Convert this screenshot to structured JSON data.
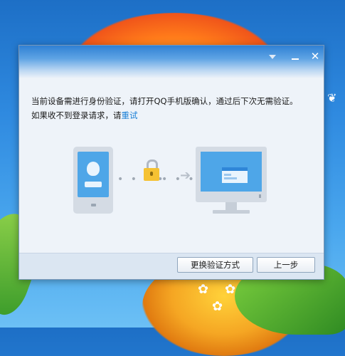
{
  "dialog": {
    "window_controls": {
      "dropdown_icon": "triangle-down-icon",
      "minimize_icon": "minimize-icon",
      "close_icon": "close-icon",
      "close_glyph": "✕"
    },
    "message": {
      "line1": "当前设备需进行身份验证，请打开QQ手机版确认，通过后下次无需验证。",
      "line2_prefix": "如果收不到登录请求，请",
      "retry_link": "重试"
    },
    "illustration": {
      "phone_icon": "qq-phone-icon",
      "lock_icon": "lock-icon",
      "arrow_icon": "arrow-right-icon",
      "monitor_icon": "computer-monitor-icon",
      "dots": "• • • •",
      "arrow_glyph": "➔"
    },
    "buttons": {
      "change_method": "更换验证方式",
      "back": "上一步"
    }
  },
  "colors": {
    "link": "#1a7fd6",
    "lock_body": "#f5c233",
    "screen_blue": "#4ea6e8"
  }
}
